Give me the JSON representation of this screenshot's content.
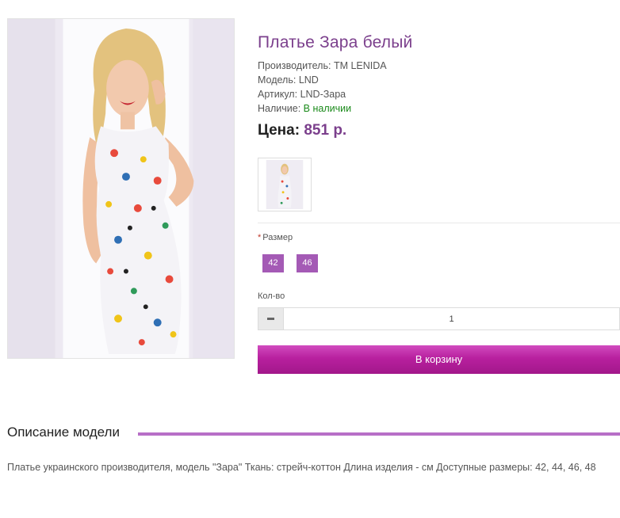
{
  "product": {
    "title": "Платье Зара белый",
    "manufacturer_label": "Производитель:",
    "manufacturer_value": "ТМ LENIDA",
    "model_label": "Модель:",
    "model_value": "LND",
    "sku_label": "Артикул:",
    "sku_value": "LND-Зара",
    "stock_label": "Наличие:",
    "stock_value": "В наличии",
    "price_label": "Цена:",
    "price_value": "851 р."
  },
  "options": {
    "size_label": "Размер",
    "size_required_mark": "*",
    "sizes": [
      "42",
      "46"
    ]
  },
  "quantity": {
    "label": "Кол-во",
    "value": "1"
  },
  "cart": {
    "button_label": "В корзину"
  },
  "description": {
    "heading": "Описание модели",
    "text": "Платье украинского производителя, модель \"Зара\" Ткань: стрейч-коттон Длина изделия - см Доступные размеры: 42, 44, 46, 48"
  },
  "colors": {
    "accent": "#7b3f8c",
    "size_button": "#a45ab5",
    "cart_button": "#b8209f",
    "in_stock": "#1a8a1a",
    "divider_line": "#b76fc7"
  },
  "icons": {
    "qty_decrease": "minus-icon"
  }
}
